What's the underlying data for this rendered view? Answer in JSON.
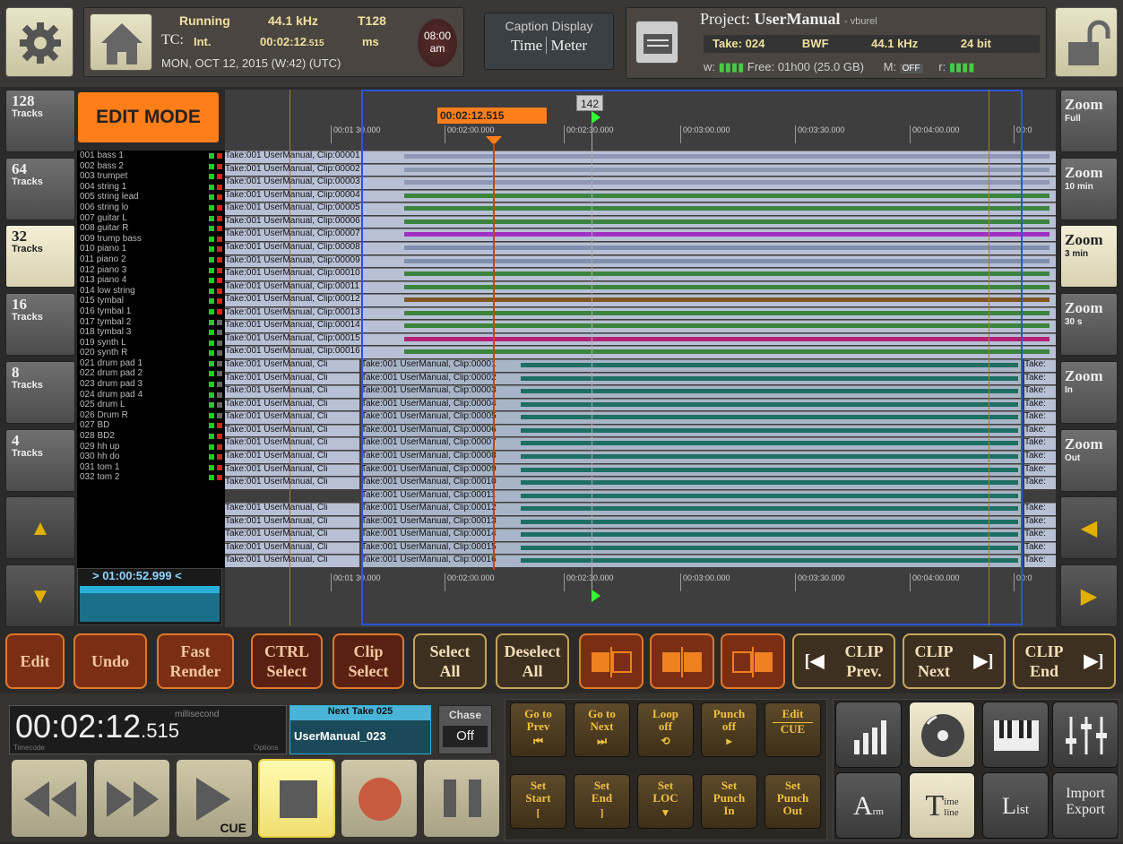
{
  "status": {
    "state": "Running",
    "sample_rate": "44.1 kHz",
    "track_count": "T128",
    "tc_label": "TC:",
    "tc_mode": "Int.",
    "tc_value": "00:02:12",
    "tc_ms": ".515",
    "unit": "ms",
    "date": "MON, OCT 12, 2015 (W:42) (UTC)",
    "clock_time": "08:00",
    "clock_ampm": "am"
  },
  "caption": {
    "title": "Caption Display",
    "time": "Time",
    "meter": "Meter"
  },
  "project": {
    "label": "Project:",
    "name": "UserManual",
    "user": "- vburel",
    "take": "Take: 024",
    "format": "BWF",
    "rate": "44.1 kHz",
    "bits": "24 bit",
    "w_label": "w:",
    "free": "Free: 01h00 (25.0 GB)",
    "m_label": "M:",
    "m_value": "OFF",
    "r_label": "r:"
  },
  "track_buttons": [
    {
      "n": "128",
      "l": "Tracks"
    },
    {
      "n": "64",
      "l": "Tracks"
    },
    {
      "n": "32",
      "l": "Tracks"
    },
    {
      "n": "16",
      "l": "Tracks"
    },
    {
      "n": "8",
      "l": "Tracks"
    },
    {
      "n": "4",
      "l": "Tracks"
    }
  ],
  "zoom_buttons": [
    {
      "n": "Zoom",
      "l": "Full"
    },
    {
      "n": "Zoom",
      "l": "10 min"
    },
    {
      "n": "Zoom",
      "l": "3 min"
    },
    {
      "n": "Zoom",
      "l": "30 s"
    },
    {
      "n": "Zoom",
      "l": "In"
    },
    {
      "n": "Zoom",
      "l": "Out"
    }
  ],
  "edit_mode": "EDIT MODE",
  "playhead": "00:02:12.515",
  "marker": "142",
  "ruler_ticks": [
    "00:01 30.000",
    "00:02:00.000",
    "00:02:30.000",
    "00:03:00.000",
    "00:03:30.000",
    "00:04:00.000",
    "00:0"
  ],
  "position_readout": "> 01:00:52.999 <",
  "tracks": [
    "001 bass 1",
    "002 bass 2",
    "003 trumpet",
    "004 string 1",
    "005 string lead",
    "006 string lo",
    "007 guitar L",
    "008 guitar R",
    "009 trump bass",
    "010 piano 1",
    "011 piano 2",
    "012 piano 3",
    "013 piano 4",
    "014 low string",
    "015 tymbal",
    "016 tymbal 1",
    "017 tymbal 2",
    "018 tymbal 3",
    "019 synth L",
    "020 synth R",
    "021 drum pad 1",
    "022 drum pad 2",
    "023 drum pad 3",
    "024 drum pad 4",
    "025 drum L",
    "026 Drum R",
    "027 BD",
    "028 BD2",
    "029 hh up",
    "030 hh do",
    "031 tom 1",
    "032 tom 2"
  ],
  "clips_upper": [
    "Take:001 UserManual, Clip:00001",
    "Take:001 UserManual, Clip:00002",
    "Take:001 UserManual, Clip:00003",
    "Take:001 UserManual, Clip:00004",
    "Take:001 UserManual, Clip:00005",
    "Take:001 UserManual, Clip:00006",
    "Take:001 UserManual, Clip:00007",
    "Take:001 UserManual, Clip:00008",
    "Take:001 UserManual, Clip:00009",
    "Take:001 UserManual, Clip:00010",
    "Take:001 UserManual, Clip:00011",
    "Take:001 UserManual, Clip:00012",
    "Take:001 UserManual, Clip:00013",
    "Take:001 UserManual, Clip:00014",
    "Take:001 UserManual, Clip:00015",
    "Take:001 UserManual, Clip:00016"
  ],
  "clips_lower_left": "Take:001 UserManual, Cli",
  "clips_lower": [
    "Take:001 UserManual, Clip:00001",
    "Take:001 UserManual, Clip:00002",
    "Take:001 UserManual, Clip:00003",
    "Take:001 UserManual, Clip:00004",
    "Take:001 UserManual, Clip:00005",
    "Take:001 UserManual, Clip:00006",
    "Take:001 UserManual, Clip:00007",
    "Take:001 UserManual, Clip:00008",
    "Take:001 UserManual, Clip:00009",
    "Take:001 UserManual, Clip:00010",
    "Take:001 UserManual, Clip:00011",
    "Take:001 UserManual, Clip:00012",
    "Take:001 UserManual, Clip:00013",
    "Take:001 UserManual, Clip:00014",
    "Take:001 UserManual, Clip:00015",
    "Take:001 UserManual, Clip:00016"
  ],
  "clips_lower_right": "Take:",
  "track_colors": [
    "#8a93b0",
    "#8a93b0",
    "#8a93b0",
    "#2d7d2d",
    "#2d7d2d",
    "#2d7d2d",
    "#a020c0",
    "#7a8aa8",
    "#7a8aa8",
    "#2d7d2d",
    "#2d7d2d",
    "#7a4a10",
    "#2d7d2d",
    "#2d7d2d",
    "#b0106a",
    "#2d7d2d"
  ],
  "edit_buttons": [
    {
      "a": "Edit",
      "b": ""
    },
    {
      "a": "Undo",
      "b": ""
    },
    {
      "a": "Fast",
      "b": "Render"
    },
    {
      "a": "CTRL",
      "b": "Select"
    },
    {
      "a": "Clip",
      "b": "Select"
    },
    {
      "a": "Select",
      "b": "All"
    },
    {
      "a": "Deselect",
      "b": "All"
    }
  ],
  "clip_nav": [
    {
      "a": "CLIP",
      "b": "Prev."
    },
    {
      "a": "CLIP",
      "b": "Next"
    },
    {
      "a": "CLIP",
      "b": "End"
    }
  ],
  "timecode": {
    "main": "00:02:12",
    "ms": ".515",
    "unit": "millisecond",
    "left_label": "Timecode",
    "right_label": "Options"
  },
  "next_take": {
    "label": "Next Take 025",
    "name": "UserManual_023"
  },
  "chase": {
    "label": "Chase",
    "value": "Off"
  },
  "cue_label": "CUE",
  "goto_buttons": [
    {
      "a": "Go to",
      "b": "Prev"
    },
    {
      "a": "Go to",
      "b": "Next"
    },
    {
      "a": "Loop",
      "b": "off"
    },
    {
      "a": "Punch",
      "b": "off"
    },
    {
      "a": "Edit",
      "b": "CUE"
    },
    {
      "a": "Set",
      "b": "Start"
    },
    {
      "a": "Set",
      "b": "End"
    },
    {
      "a": "Set",
      "b": "LOC"
    },
    {
      "a": "Set",
      "b": "Punch",
      "c": "In"
    },
    {
      "a": "Set",
      "b": "Punch",
      "c": "Out"
    }
  ],
  "right_panel": {
    "arm": "A",
    "arm_sub": "rm",
    "timeline_t": "T",
    "timeline_sub1": "ime",
    "timeline_sub2": "line",
    "list": "L",
    "list_sub": "ist",
    "import": "Import",
    "export": "Export"
  }
}
